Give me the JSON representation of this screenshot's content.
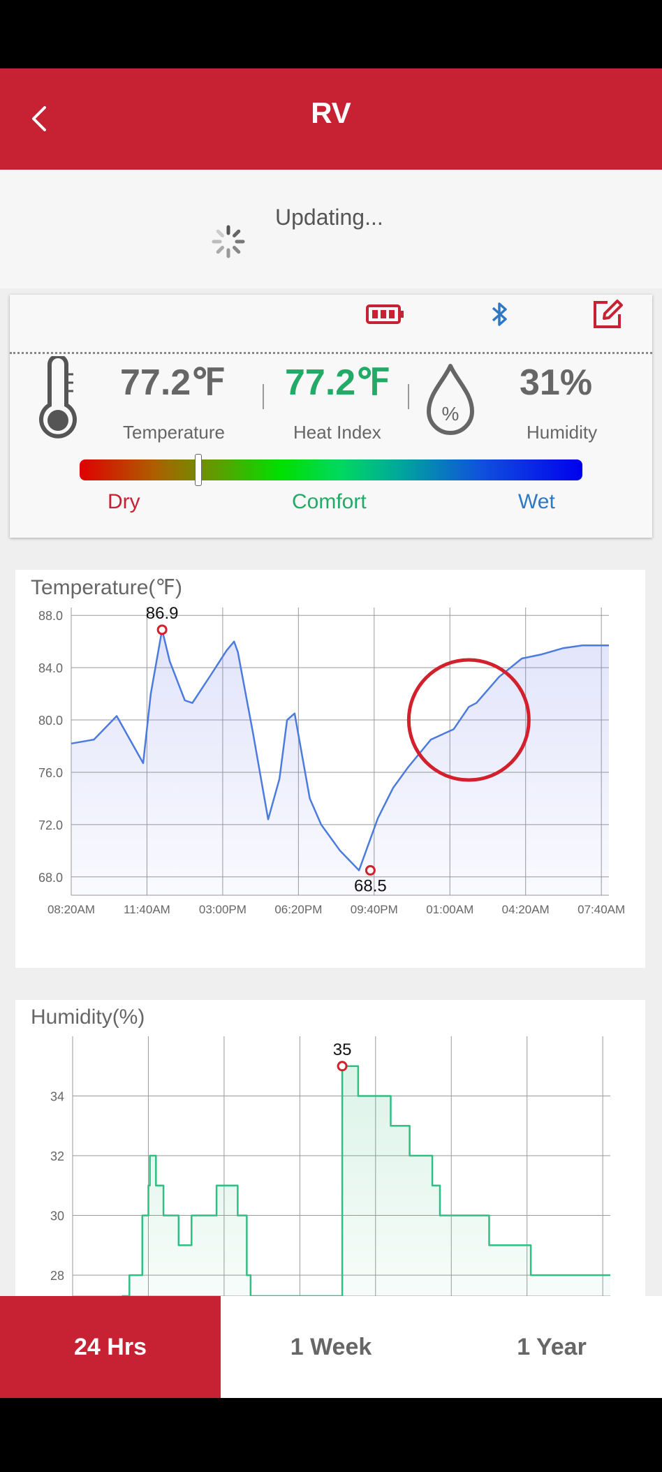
{
  "header": {
    "title": "RV"
  },
  "status": {
    "text": "Updating..."
  },
  "sensor": {
    "temperature_value": "77.2℉",
    "temperature_label": "Temperature",
    "heat_index_value": "77.2℉",
    "heat_index_label": "Heat Index",
    "humidity_value": "31%",
    "humidity_label": "Humidity",
    "humidity_icon_text": "%",
    "comfort_marker_position": 0.235,
    "scale_labels": {
      "dry": "Dry",
      "comfort": "Comfort",
      "wet": "Wet"
    }
  },
  "colors": {
    "brand": "#c62234",
    "temperature_line": "#4b7bde",
    "humidity_line": "#2ebf82",
    "heat_index": "#22aa66",
    "wet": "#2f78c4"
  },
  "icons": [
    "back-chevron-icon",
    "spinner-icon",
    "battery-icon",
    "bluetooth-icon",
    "edit-icon",
    "thermometer-icon",
    "humidity-drop-icon"
  ],
  "tabs": [
    {
      "label": "24 Hrs",
      "active": true
    },
    {
      "label": "1 Week",
      "active": false
    },
    {
      "label": "1 Year",
      "active": false
    }
  ],
  "chart_data": [
    {
      "type": "area",
      "title": "Temperature(℉)",
      "x_tick_labels": [
        "08:20AM",
        "11:40AM",
        "03:00PM",
        "06:20PM",
        "09:40PM",
        "01:00AM",
        "04:20AM",
        "07:40AM"
      ],
      "y_ticks": [
        68.0,
        72.0,
        76.0,
        80.0,
        84.0,
        88.0
      ],
      "ylim": [
        66.6,
        88.6
      ],
      "xlim": [
        0,
        7.1
      ],
      "x_unit": "tick intervals (3h20m each) from 08:20AM",
      "series": [
        {
          "x": [
            0,
            0.3,
            0.55,
            0.6,
            0.95,
            1.05,
            1.2,
            1.3,
            1.5,
            1.6,
            1.85,
            2.05,
            2.15,
            2.2,
            2.4,
            2.6,
            2.75,
            2.85,
            2.95,
            3.15,
            3.3,
            3.55,
            3.8,
            4.05,
            4.25,
            4.45,
            4.75,
            5.05,
            5.25,
            5.35,
            5.65,
            5.95,
            6.2,
            6.5,
            6.75,
            7.1
          ],
          "y": [
            78.2,
            78.5,
            80.0,
            80.3,
            76.7,
            82.0,
            86.9,
            84.5,
            81.5,
            81.3,
            83.5,
            85.3,
            86.0,
            85.2,
            79.0,
            72.4,
            75.5,
            80.0,
            80.5,
            74.0,
            72.0,
            70.0,
            68.5,
            72.5,
            74.8,
            76.4,
            78.5,
            79.3,
            81.0,
            81.3,
            83.3,
            84.7,
            85.0,
            85.5,
            85.7,
            85.7
          ]
        }
      ],
      "annotations": [
        {
          "label": "86.9",
          "x": 1.2,
          "y": 86.9,
          "kind": "max"
        },
        {
          "label": "68.5",
          "x": 3.95,
          "y": 68.5,
          "kind": "min"
        }
      ],
      "highlight_circle": {
        "x": 5.25,
        "y": 80.0,
        "color": "#d3202d"
      },
      "grid": true
    },
    {
      "type": "area",
      "title": "Humidity(%)",
      "y_ticks": [
        28,
        30,
        32,
        34
      ],
      "ylim": [
        27.3,
        36.0
      ],
      "xlim": [
        0,
        7.1
      ],
      "series": [
        {
          "x": [
            0.65,
            0.75,
            0.92,
            1.0,
            1.02,
            1.1,
            1.2,
            1.4,
            1.57,
            1.9,
            2.18,
            2.3,
            2.35,
            2.5,
            2.51,
            3.45,
            3.56,
            3.77,
            4.2,
            4.45,
            4.75,
            4.85,
            5.5,
            5.75,
            6.05,
            6.2,
            6.5,
            7.1
          ],
          "y": [
            27.3,
            28,
            30,
            31,
            32,
            31,
            30,
            29,
            30,
            31,
            30,
            28,
            27.3,
            27.3,
            27.3,
            27.3,
            35,
            34,
            33,
            32,
            31,
            30,
            29,
            29,
            28,
            28,
            28,
            28
          ]
        }
      ],
      "annotations": [
        {
          "label": "35",
          "x": 3.56,
          "y": 35,
          "kind": "max"
        }
      ],
      "grid": true
    }
  ]
}
